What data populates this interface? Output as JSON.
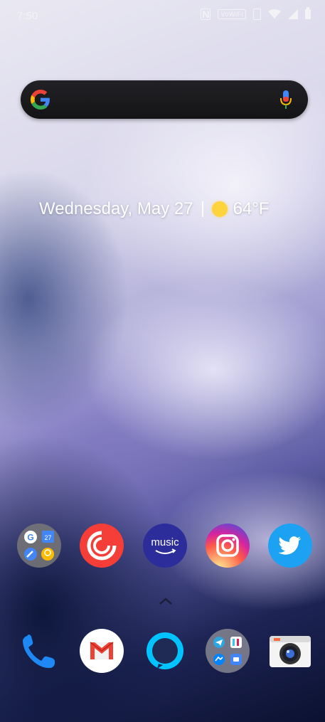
{
  "status_bar": {
    "time": "7:50",
    "nfc_label": "N",
    "wifi_badge": "VoWiFi",
    "icons": [
      "nfc-icon",
      "vowifi-icon",
      "vibrate-icon",
      "wifi-icon",
      "cellular-signal-icon",
      "battery-icon"
    ]
  },
  "search_bar": {
    "logo": "google-g-icon",
    "mic": "mic-icon"
  },
  "at_a_glance": {
    "date": "Wednesday, May 27",
    "weather_icon": "sun-icon",
    "temperature": "64°F"
  },
  "home_apps": [
    {
      "name": "Google folder",
      "icon": "google-folder-icon"
    },
    {
      "name": "Pocket Casts",
      "icon": "pocketcasts-icon"
    },
    {
      "name": "Amazon Music",
      "icon": "amazon-music-icon",
      "label": "music"
    },
    {
      "name": "Instagram",
      "icon": "instagram-icon"
    },
    {
      "name": "Twitter",
      "icon": "twitter-icon"
    }
  ],
  "folder_google_badge": "27",
  "dock_apps": [
    {
      "name": "Phone",
      "icon": "phone-icon"
    },
    {
      "name": "Gmail",
      "icon": "gmail-icon"
    },
    {
      "name": "Amazon Alexa",
      "icon": "alexa-icon"
    },
    {
      "name": "Social folder",
      "icon": "social-folder-icon"
    },
    {
      "name": "Camera",
      "icon": "camera-icon"
    }
  ],
  "colors": {
    "google_blue": "#4285F4",
    "google_red": "#EA4335",
    "google_yellow": "#FBBC05",
    "google_green": "#34A853",
    "twitter_blue": "#1DA1F2",
    "pocketcasts_red": "#F43E37"
  }
}
